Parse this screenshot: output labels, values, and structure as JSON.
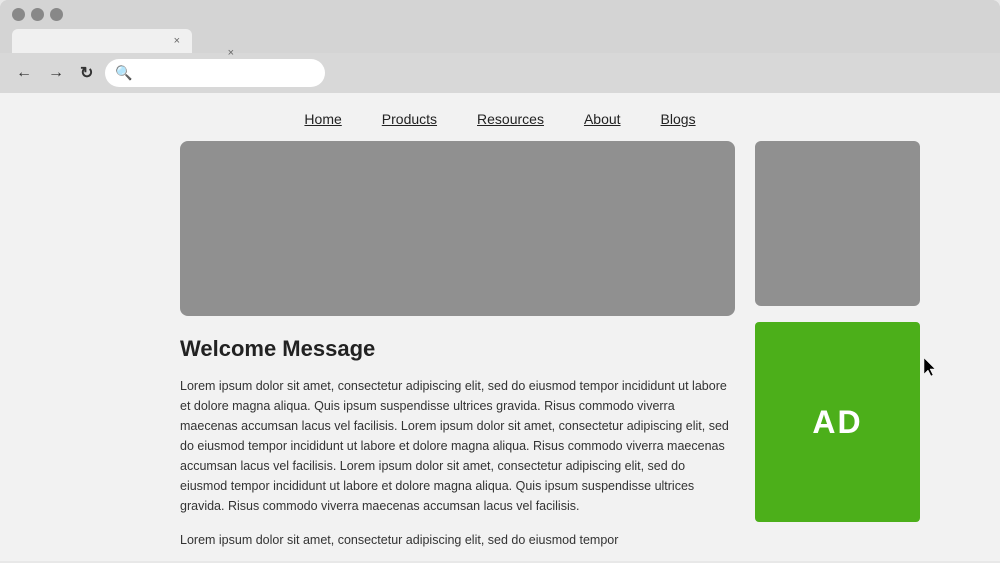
{
  "browser": {
    "traffic_lights": [
      "red",
      "yellow",
      "green"
    ],
    "tabs": [
      {
        "label": "",
        "active": true,
        "close": "×"
      },
      {
        "label": "",
        "active": false,
        "close": "×"
      }
    ],
    "nav_back": "←",
    "nav_forward": "→",
    "nav_refresh": "↻",
    "search_icon": "🔍",
    "address_bar_placeholder": ""
  },
  "nav": {
    "items": [
      {
        "label": "Home",
        "id": "home"
      },
      {
        "label": "Products",
        "id": "products"
      },
      {
        "label": "Resources",
        "id": "resources"
      },
      {
        "label": "About",
        "id": "about"
      },
      {
        "label": "Blogs",
        "id": "blogs"
      }
    ]
  },
  "welcome": {
    "title": "Welcome Message",
    "body1": "Lorem ipsum dolor sit amet, consectetur adipiscing elit, sed do eiusmod tempor incididunt ut labore et dolore magna aliqua. Quis ipsum suspendisse ultrices gravida. Risus commodo viverra maecenas accumsan lacus vel facilisis. Lorem ipsum dolor sit amet, consectetur adipiscing elit, sed do eiusmod tempor incididunt ut labore et dolore magna aliqua. Risus commodo viverra maecenas accumsan lacus vel facilisis. Lorem ipsum dolor sit amet, consectetur adipiscing elit, sed do eiusmod tempor incididunt ut labore et dolore magna aliqua. Quis ipsum suspendisse ultrices gravida. Risus commodo viverra maecenas accumsan lacus vel facilisis.",
    "body2": "Lorem ipsum dolor sit amet, consectetur adipiscing elit, sed do eiusmod tempor"
  },
  "ad": {
    "label": "AD",
    "color": "#4caf1a"
  }
}
